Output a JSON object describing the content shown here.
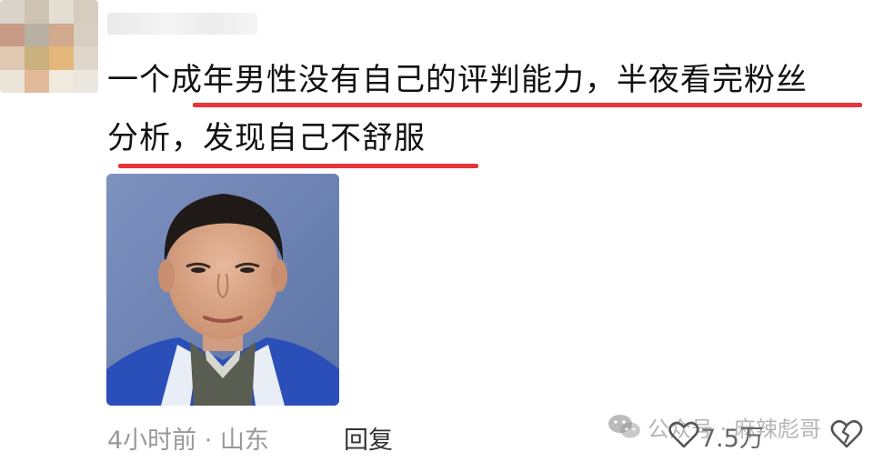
{
  "comment": {
    "line1": "一个成年男性没有自己的评判能力，半夜看完粉丝",
    "line2": "分析，发现自己不舒服"
  },
  "meta": {
    "time_location": "4小时前 · 山东",
    "reply_label": "回复",
    "like_count": "7.5万"
  },
  "watermark": {
    "text": "公众号 · 麻辣彪哥"
  },
  "icons": {
    "like": "heart-outline-icon",
    "dislike": "broken-heart-icon",
    "watermark": "wechat-icon"
  },
  "colors": {
    "underline": "#e8343a",
    "meta_text": "#999999",
    "reply_text": "#333333"
  }
}
